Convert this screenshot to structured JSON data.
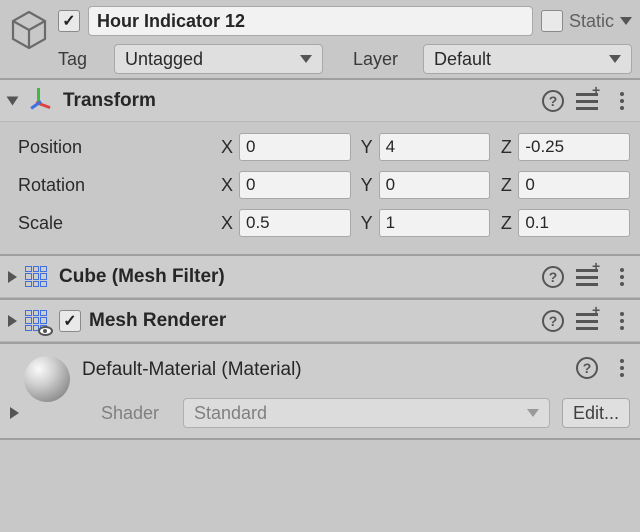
{
  "header": {
    "active": true,
    "name": "Hour Indicator 12",
    "static_label": "Static",
    "tag_label": "Tag",
    "tag_value": "Untagged",
    "layer_label": "Layer",
    "layer_value": "Default"
  },
  "transform": {
    "title": "Transform",
    "position": {
      "label": "Position",
      "x": "0",
      "y": "4",
      "z": "-0.25"
    },
    "rotation": {
      "label": "Rotation",
      "x": "0",
      "y": "0",
      "z": "0"
    },
    "scale": {
      "label": "Scale",
      "x": "0.5",
      "y": "1",
      "z": "0.1"
    },
    "axis": {
      "x": "X",
      "y": "Y",
      "z": "Z"
    }
  },
  "meshFilter": {
    "title": "Cube (Mesh Filter)"
  },
  "meshRenderer": {
    "title": "Mesh Renderer",
    "enabled": true
  },
  "material": {
    "title": "Default-Material (Material)",
    "shader_label": "Shader",
    "shader_value": "Standard",
    "edit_label": "Edit..."
  },
  "icons": {
    "help": "?",
    "plus": "+"
  }
}
